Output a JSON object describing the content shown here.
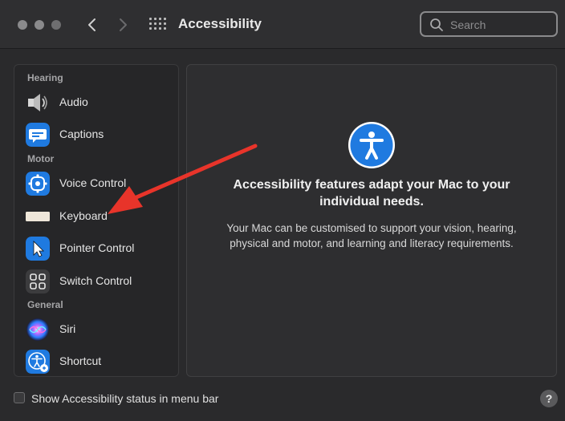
{
  "window": {
    "title": "Accessibility",
    "search_placeholder": "Search"
  },
  "sidebar": {
    "sections": [
      {
        "label": "Hearing"
      },
      {
        "label": "Motor"
      },
      {
        "label": "General"
      }
    ],
    "items": [
      {
        "label": "Audio",
        "icon": "speaker-icon"
      },
      {
        "label": "Captions",
        "icon": "captions-icon"
      },
      {
        "label": "Voice Control",
        "icon": "voice-control-icon"
      },
      {
        "label": "Keyboard",
        "icon": "keyboard-icon"
      },
      {
        "label": "Pointer Control",
        "icon": "pointer-icon"
      },
      {
        "label": "Switch Control",
        "icon": "switch-control-icon"
      },
      {
        "label": "Siri",
        "icon": "siri-icon"
      },
      {
        "label": "Shortcut",
        "icon": "accessibility-shortcut-icon"
      }
    ]
  },
  "main": {
    "headline_line1": "Accessibility features adapt your Mac to your",
    "headline_line2": "individual needs.",
    "body_line1": "Your Mac can be customised to support your vision, hearing,",
    "body_line2": "physical and motor, and learning and literacy requirements."
  },
  "footer": {
    "checkbox_label": "Show Accessibility status in menu bar",
    "checkbox_checked": false,
    "help_label": "?"
  },
  "colors": {
    "accent_blue": "#1f7ae0",
    "annotation_arrow": "#e8342a"
  }
}
